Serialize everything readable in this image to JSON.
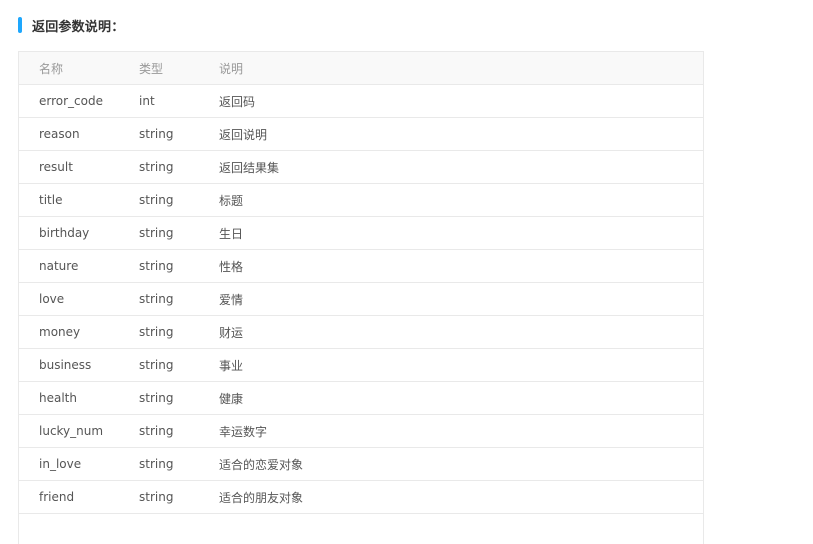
{
  "section": {
    "title": "返回参数说明："
  },
  "colors": {
    "accent": "#1ea7fd",
    "border": "#e9e9e9",
    "header_bg": "#f9f9f9"
  },
  "table": {
    "columns": [
      "名称",
      "类型",
      "说明"
    ],
    "rows": [
      {
        "name": "error_code",
        "type": "int",
        "desc": "返回码"
      },
      {
        "name": "reason",
        "type": "string",
        "desc": "返回说明"
      },
      {
        "name": "result",
        "type": "string",
        "desc": "返回结果集"
      },
      {
        "name": "title",
        "type": "string",
        "desc": "标题"
      },
      {
        "name": "birthday",
        "type": "string",
        "desc": "生日"
      },
      {
        "name": "nature",
        "type": "string",
        "desc": "性格"
      },
      {
        "name": "love",
        "type": "string",
        "desc": "爱情"
      },
      {
        "name": "money",
        "type": "string",
        "desc": "财运"
      },
      {
        "name": "business",
        "type": "string",
        "desc": "事业"
      },
      {
        "name": "health",
        "type": "string",
        "desc": "健康"
      },
      {
        "name": "lucky_num",
        "type": "string",
        "desc": "幸运数字"
      },
      {
        "name": "in_love",
        "type": "string",
        "desc": "适合的恋爱对象"
      },
      {
        "name": "friend",
        "type": "string",
        "desc": "适合的朋友对象"
      }
    ]
  }
}
